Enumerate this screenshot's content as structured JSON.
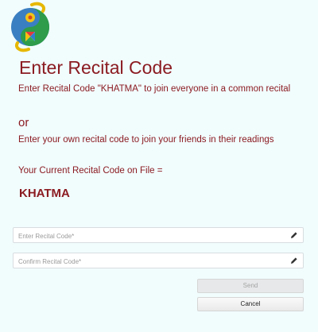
{
  "header": {
    "title": "Enter Recital Code"
  },
  "intro": {
    "line1": "Enter Recital Code \"KHATMA\" to join everyone in a common recital",
    "or": "or",
    "line2": "Enter your own recital code to join your friends in their readings",
    "current_label": "Your Current Recital Code on File =",
    "current_code": "KHATMA"
  },
  "form": {
    "code_placeholder": "Enter Recital Code*",
    "confirm_placeholder": "Confirm Recital Code*",
    "send_label": "Send",
    "cancel_label": "Cancel"
  },
  "icons": {
    "edit": "pencil-icon",
    "logo": "yin-yang-logo"
  },
  "colors": {
    "text": "#8b1c22",
    "background": "#f1fcfd"
  }
}
